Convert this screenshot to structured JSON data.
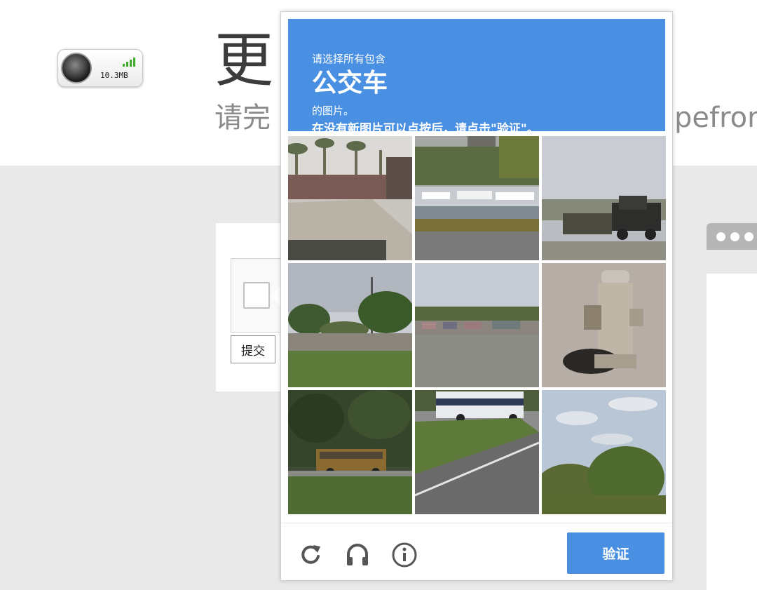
{
  "header": {
    "title": "更",
    "subtitle_left": "请完",
    "subtitle_right": "pefron"
  },
  "network_widget": {
    "size_text": "10.3MB",
    "signal_icon": "signal-bars-icon"
  },
  "form": {
    "submit_label": "提交"
  },
  "challenge": {
    "instruction": "请选择所有包含",
    "target_object": "公交车",
    "suffix": "的图片。",
    "hint": "在没有新图片可以点按后，请点击\"验证\"。",
    "tiles": [
      {
        "index": 1,
        "scene": "palm trees and lot"
      },
      {
        "index": 2,
        "scene": "harbor with boats"
      },
      {
        "index": 3,
        "scene": "truck on road"
      },
      {
        "index": 4,
        "scene": "park with trees"
      },
      {
        "index": 5,
        "scene": "parking lot"
      },
      {
        "index": 6,
        "scene": "fire hydrant"
      },
      {
        "index": 7,
        "scene": "school bus in trees"
      },
      {
        "index": 8,
        "scene": "bus on curving road"
      },
      {
        "index": 9,
        "scene": "sky and treeline"
      }
    ],
    "footer": {
      "reload_icon": "reload-icon",
      "audio_icon": "headphones-icon",
      "info_icon": "info-icon",
      "verify_label": "验证"
    },
    "colors": {
      "accent": "#4a90e2"
    }
  }
}
